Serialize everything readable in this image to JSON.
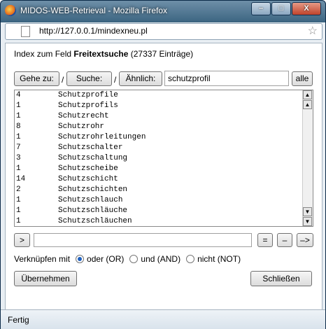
{
  "window": {
    "title": "MIDOS-WEB-Retrieval - Mozilla Firefox",
    "controls": [
      "–",
      "□",
      "X"
    ]
  },
  "urlbar": {
    "url": "http://127.0.0.1/mindexneu.pl"
  },
  "heading": {
    "prefix": "Index zum Feld ",
    "field": "Freitextsuche",
    "count": "(27337 Einträge)"
  },
  "toolbar": {
    "goto_label": "Gehe zu:",
    "sep1": "/",
    "search_label": "Suche:",
    "sep2": "/",
    "similar_label": "Ähnlich:",
    "query": "schutzprofil",
    "all_label": "alle"
  },
  "list": {
    "items": [
      {
        "count": "4",
        "term": "Schutzprofile"
      },
      {
        "count": "1",
        "term": "Schutzprofils"
      },
      {
        "count": "1",
        "term": "Schutzrecht"
      },
      {
        "count": "8",
        "term": "Schutzrohr"
      },
      {
        "count": "1",
        "term": "Schutzrohrleitungen"
      },
      {
        "count": "7",
        "term": "Schutzschalter"
      },
      {
        "count": "3",
        "term": "Schutzschaltung"
      },
      {
        "count": "1",
        "term": "Schutzscheibe"
      },
      {
        "count": "14",
        "term": "Schutzschicht"
      },
      {
        "count": "2",
        "term": "Schutzschichten"
      },
      {
        "count": "1",
        "term": "Schutzschlauch"
      },
      {
        "count": "1",
        "term": "Schutzschläuche"
      },
      {
        "count": "1",
        "term": "Schutzschläuchen"
      }
    ]
  },
  "nav": {
    "forward_label": ">",
    "equals_label": "=",
    "minus_label": "–",
    "arrow_label": "–>"
  },
  "operators": {
    "label": "Verknüpfen mit",
    "or_label": "oder (OR)",
    "and_label": "und (AND)",
    "not_label": "nicht (NOT)",
    "selected": "or"
  },
  "actions": {
    "apply_label": "Übernehmen",
    "close_label": "Schließen"
  },
  "status": {
    "text": "Fertig"
  }
}
